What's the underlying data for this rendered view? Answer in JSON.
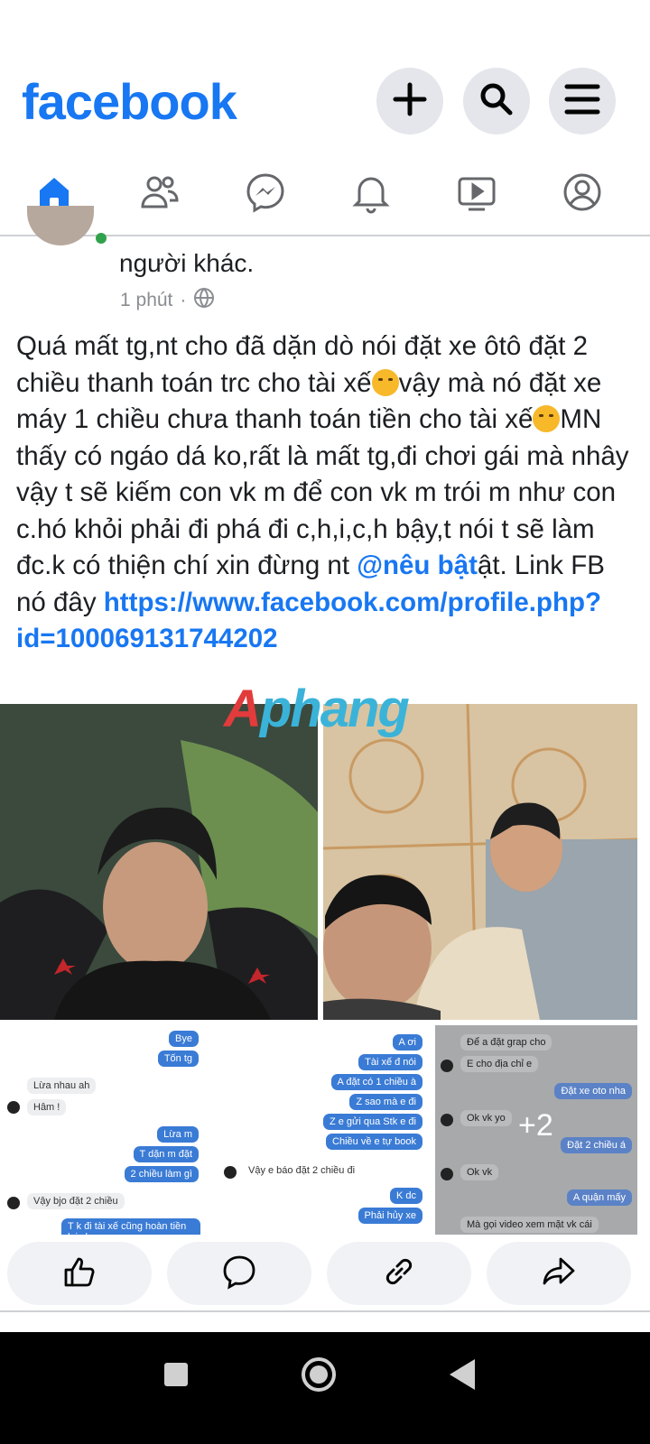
{
  "header": {
    "logo": "facebook"
  },
  "icons": {
    "add": "plus-icon",
    "search": "search-icon",
    "menu": "hamburger-menu-icon",
    "tabs": [
      "home-icon",
      "friends-icon",
      "messenger-icon",
      "notifications-icon",
      "watch-icon",
      "profile-icon"
    ]
  },
  "colors": {
    "brand": "#1877f2",
    "link": "#1877f2",
    "watermark_red": "#e23b3b",
    "watermark_blue": "#3bb3d9"
  },
  "post": {
    "subtitle": "người khác.",
    "time": "1 phút",
    "dot": "·",
    "text_1": "Quá mất tg,nt cho đã dặn dò nói đặt xe ôtô đặt 2 chiều thanh toán trc cho tài xế",
    "text_2": "vậy mà nó đặt xe máy 1 chiều chưa thanh toán tiền cho tài xế",
    "text_3": "MN thấy có ngáo dá ko,rất là mất tg,đi chơi gái mà nhây vậy t sẽ kiếm con vk m để con vk m trói m như con c.hó khỏi phải đi phá đi c,h,i,c,h bậy,t nói t sẽ làm đc.k có thiện chí xin đừng nt ",
    "mention": "@nêu bật",
    "text_4": "ật. Link FB nó đây ",
    "link": "https://www.facebook.com/profile.php?id=100069131744202",
    "emoji_1": "unamused-face-icon",
    "emoji_2": "worried-face-icon",
    "watermark_a": "A",
    "watermark_b": "phang"
  },
  "chat1": {
    "r1": "Bye",
    "r2": "Tốn tg",
    "l1": "Lừa nhau ah",
    "l2": "Hâm !",
    "r3": "Lừa m",
    "r4": "T dặn m đặt",
    "r5": "2 chiều làm gì",
    "l3": "Vậy bjo đặt 2 chiều",
    "r6": "T k đi tài xế cũng hoàn tiền lại cho m"
  },
  "chat2": {
    "r1": "A ơi",
    "r2": "Tài xế đ nói",
    "r3": "A đặt có 1 chiều à",
    "r4": "Z sao mà e đi",
    "r5": "Z e gửi qua Stk e đi",
    "r6": "Chiều về e tự book",
    "l1": "Vậy e báo đặt 2 chiều đi",
    "r7": "K dc",
    "r8": "Phải hủy xe"
  },
  "chat3": {
    "l1": "Để a đặt grap cho",
    "l2": "E cho địa chỉ e",
    "r1": "Đặt xe oto nha",
    "l3": "Ok vk yo",
    "r2": "Đặt 2 chiều á",
    "l4": "Ok vk",
    "r3": "A quận mấy",
    "l5": "Mà gọi video xem mặt vk cái",
    "more": "+2"
  },
  "actions": [
    "like-icon",
    "comment-icon",
    "share-link-icon",
    "share-icon"
  ],
  "nav": [
    "recent-apps-icon",
    "home-button-icon",
    "back-icon"
  ]
}
